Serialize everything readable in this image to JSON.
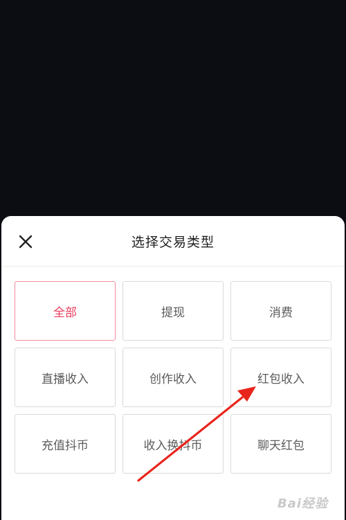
{
  "sheet": {
    "title": "选择交易类型",
    "close_icon": "close-icon"
  },
  "options": [
    {
      "label": "全部",
      "selected": true
    },
    {
      "label": "提现",
      "selected": false
    },
    {
      "label": "消费",
      "selected": false
    },
    {
      "label": "直播收入",
      "selected": false
    },
    {
      "label": "创作收入",
      "selected": false
    },
    {
      "label": "红包收入",
      "selected": false
    },
    {
      "label": "充值抖币",
      "selected": false
    },
    {
      "label": "收入换抖币",
      "selected": false
    },
    {
      "label": "聊天红包",
      "selected": false
    }
  ],
  "colors": {
    "selected_text": "#ea3d5f",
    "selected_border": "#f28a9e",
    "annotation_arrow": "#e8251b",
    "backdrop": "#0c0d12"
  },
  "watermark": {
    "text": "Bai经验"
  }
}
